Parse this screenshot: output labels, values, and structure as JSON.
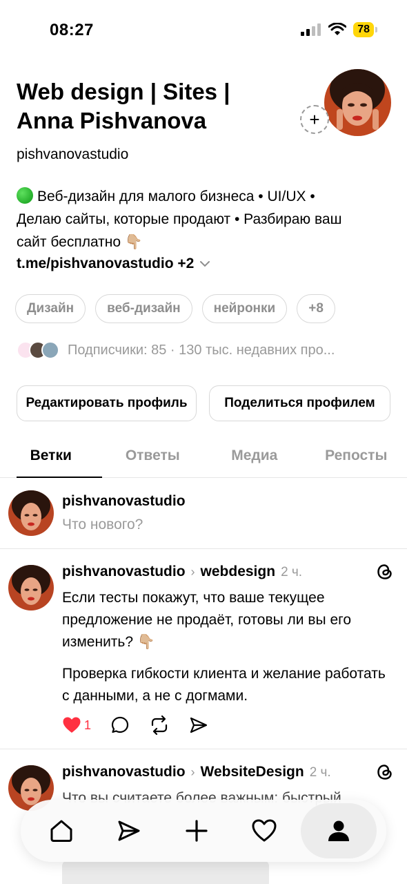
{
  "status_bar": {
    "time": "08:27",
    "battery": "78"
  },
  "profile": {
    "name_line1": "Web design | Sites |",
    "name_line2": "Anna Pishvanova",
    "username": "pishvanovastudio",
    "bio_line1": "Веб-дизайн для малого бизнеса • UI/UX •",
    "bio_line2": "Делаю сайты, которые продают • Разбираю ваш",
    "bio_line3": "сайт бесплатно 👇🏼",
    "link": "t.me/pishvanovastudio +2",
    "add_symbol": "+"
  },
  "chips": [
    {
      "label": "Дизайн"
    },
    {
      "label": "веб-дизайн"
    },
    {
      "label": "нейронки"
    },
    {
      "label": "+8"
    }
  ],
  "followers_text": "Подписчики: 85 · 130 тыс. недавних про...",
  "buttons": {
    "edit": "Редактировать профиль",
    "share": "Поделиться профилем"
  },
  "tabs": [
    "Ветки",
    "Ответы",
    "Медиа",
    "Репосты"
  ],
  "composer": {
    "username": "pishvanovastudio",
    "placeholder": "Что нового?"
  },
  "posts": [
    {
      "username": "pishvanovastudio",
      "topic": "webdesign",
      "time": "2 ч.",
      "p1": "Если тесты покажут, что ваше текущее предложение не продаёт, готовы ли вы его изменить? 👇🏼",
      "p2": "Проверка гибкости клиента и желание работать с данными, а не с догмами.",
      "likes": "1"
    },
    {
      "username": "pishvanovastudio",
      "topic": "WebsiteDesign",
      "time": "2 ч.",
      "p1": "Что вы считаете более важным: быстрый"
    }
  ],
  "colors": {
    "like": "#ff3040",
    "battery": "#ffd60a",
    "muted": "#9a9a9a"
  },
  "nav_icons": [
    "home-icon",
    "send-icon",
    "plus-icon",
    "heart-icon",
    "profile-icon"
  ]
}
